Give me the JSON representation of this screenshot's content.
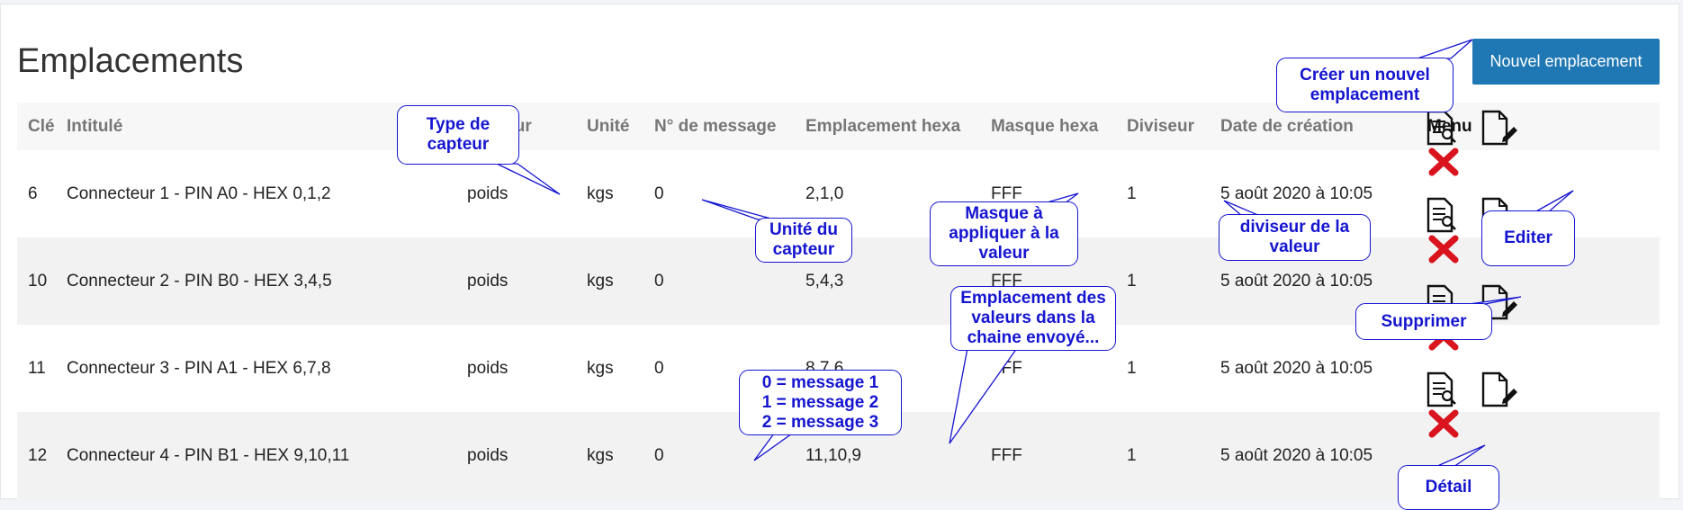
{
  "page": {
    "title": "Emplacements",
    "new_button": "Nouvel emplacement"
  },
  "table": {
    "headers": [
      "Clé",
      "Intitulé",
      "Capteur",
      "Unité",
      "N° de message",
      "Emplacement hexa",
      "Masque hexa",
      "Diviseur",
      "Date de création",
      "Menu"
    ],
    "rows": [
      [
        "6",
        "Connecteur 1 - PIN A0 - HEX 0,1,2",
        "poids",
        "kgs",
        "0",
        "2,1,0",
        "FFF",
        "1",
        "5 août 2020 à 10:05"
      ],
      [
        "10",
        "Connecteur 2 - PIN B0 - HEX 3,4,5",
        "poids",
        "kgs",
        "0",
        "5,4,3",
        "FFF",
        "1",
        "5 août 2020 à 10:05"
      ],
      [
        "11",
        "Connecteur 3 - PIN A1 - HEX 6,7,8",
        "poids",
        "kgs",
        "0",
        "8,7,6",
        "FFF",
        "1",
        "5 août 2020 à 10:05"
      ],
      [
        "12",
        "Connecteur 4 - PIN B1 - HEX 9,10,11",
        "poids",
        "kgs",
        "0",
        "11,10,9",
        "FFF",
        "1",
        "5 août 2020 à 10:05"
      ]
    ],
    "row_icons": [
      "view-detail-icon",
      "edit-icon",
      "delete-icon"
    ]
  },
  "annotations": {
    "create": "Créer un nouvel emplacement",
    "sensor_type": "Type de capteur",
    "unit": "Unité du capteur",
    "mask": "Masque à appliquer à la valeur",
    "divisor": "diviseur de la valeur",
    "edit": "Editer",
    "location": "Emplacement des valeurs dans la chaine envoyé...",
    "delete": "Supprimer",
    "message": "0 = message 1\n1 = message 2\n2 = message 3",
    "detail": "Détail"
  },
  "colors": {
    "primary_button": "#1f78b4",
    "annotation": "#1515d0",
    "delete": "#d9141e"
  }
}
